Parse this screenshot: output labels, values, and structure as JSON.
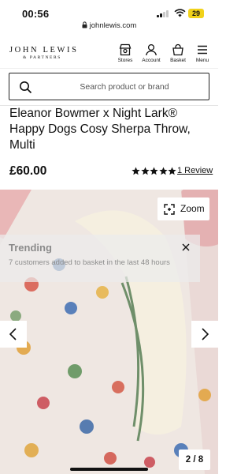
{
  "status_bar": {
    "time": "00:56",
    "battery": "29"
  },
  "browser": {
    "url": "johnlewis.com"
  },
  "header": {
    "logo_main": "JOHN LEWIS",
    "logo_sub": "& PARTNERS",
    "nav": [
      {
        "label": "Stores",
        "icon": "store-icon"
      },
      {
        "label": "Account",
        "icon": "account-icon"
      },
      {
        "label": "Basket",
        "icon": "basket-icon"
      },
      {
        "label": "Menu",
        "icon": "menu-icon"
      }
    ]
  },
  "search": {
    "placeholder": "Search product or brand"
  },
  "product": {
    "title": "Eleanor Bowmer x Night Lark® Happy Dogs Cosy Sherpa Throw, Multi",
    "price": "£60.00",
    "rating": 5,
    "review_link": "1 Review"
  },
  "gallery": {
    "zoom_label": "Zoom",
    "counter": "2 / 8"
  },
  "trending": {
    "title": "Trending",
    "text": "7 customers added to basket in the last 48 hours"
  },
  "colors": {
    "brand": "#111111",
    "battery": "#f1d21a",
    "blanket_trim": "#6f8f6a"
  }
}
